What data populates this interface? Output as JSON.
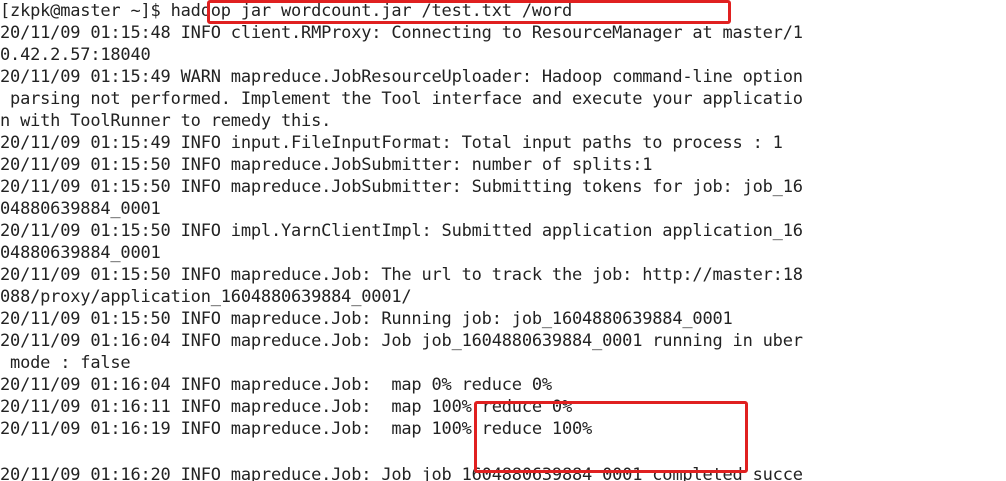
{
  "terminal": {
    "prompt": "[zkpk@master ~]$ ",
    "command": "hadoop jar wordcount.jar /test.txt /word",
    "lines": [
      "20/11/09 01:15:48 INFO client.RMProxy: Connecting to ResourceManager at master/1",
      "0.42.2.57:18040",
      "20/11/09 01:15:49 WARN mapreduce.JobResourceUploader: Hadoop command-line option",
      " parsing not performed. Implement the Tool interface and execute your applicatio",
      "n with ToolRunner to remedy this.",
      "20/11/09 01:15:49 INFO input.FileInputFormat: Total input paths to process : 1",
      "20/11/09 01:15:50 INFO mapreduce.JobSubmitter: number of splits:1",
      "20/11/09 01:15:50 INFO mapreduce.JobSubmitter: Submitting tokens for job: job_16",
      "04880639884_0001",
      "20/11/09 01:15:50 INFO impl.YarnClientImpl: Submitted application application_16",
      "04880639884_0001",
      "20/11/09 01:15:50 INFO mapreduce.Job: The url to track the job: http://master:18",
      "088/proxy/application_1604880639884_0001/",
      "20/11/09 01:15:50 INFO mapreduce.Job: Running job: job_1604880639884_0001",
      "20/11/09 01:16:04 INFO mapreduce.Job: Job job_1604880639884_0001 running in uber",
      " mode : false"
    ],
    "progress_lines": [
      {
        "prefix": "20/11/09 01:16:04 INFO mapreduce.Job: ",
        "status": " map 0% reduce 0%"
      },
      {
        "prefix": "20/11/09 01:16:11 INFO mapreduce.Job: ",
        "status": " map 100% reduce 0%"
      },
      {
        "prefix": "20/11/09 01:16:19 INFO mapreduce.Job: ",
        "status": " map 100% reduce 100%"
      }
    ],
    "partial_line": "20/11/09 01:16:20 INFO mapreduce.Job: Job job_1604880639884_0001 completed succe"
  },
  "colors": {
    "background": "#ffffff",
    "text": "#222222",
    "highlight": "#e02020"
  }
}
